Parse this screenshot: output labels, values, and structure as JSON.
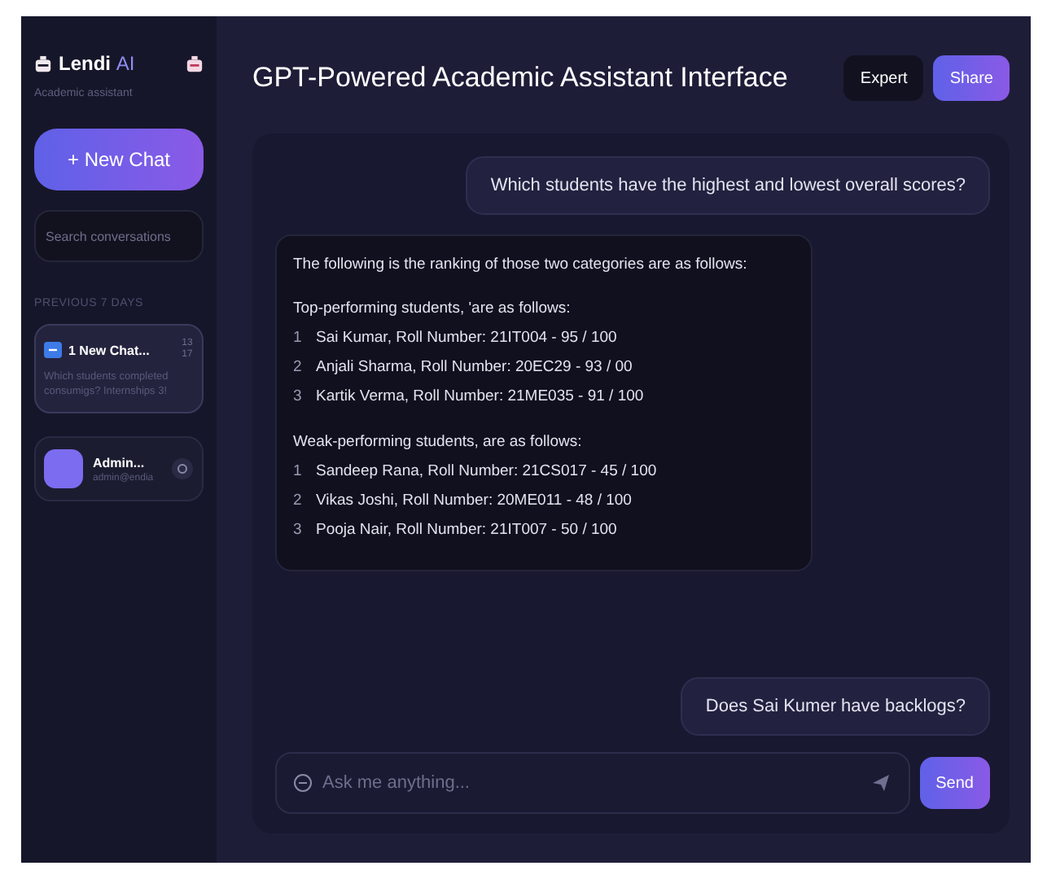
{
  "sidebar": {
    "brand": {
      "name": "Lendi",
      "suffix": "AI"
    },
    "subtitle": "Academic assistant",
    "new_chat": "+ New Chat",
    "search": {
      "placeholder": "Search conversations"
    },
    "section": "PREVIOUS 7 DAYS",
    "conversations": [
      {
        "title": "1 New Chat...",
        "time": "13 17",
        "preview": "Which students completed consumigs? Internships 3!",
        "selected": true
      }
    ],
    "user": {
      "name": "Admin...",
      "email": "admin@endia"
    }
  },
  "header": {
    "title": "GPT-Powered Academic Assistant Interface",
    "buttons": [
      {
        "label": "Expert",
        "kind": "plain"
      },
      {
        "label": "Share",
        "kind": "primary"
      }
    ]
  },
  "messages": [
    {
      "kind": "user",
      "text": "Which students have the highest and lowest overall scores?"
    },
    {
      "kind": "assistant",
      "intro": "The following is the ranking of those two categories are as follows:",
      "groups": [
        {
          "heading": "Top-performing students, 'are as follows:",
          "items": [
            {
              "num": "1",
              "text": "Sai Kumar, Roll Number: 21IT004 - 95 / 100"
            },
            {
              "num": "2",
              "text": "Anjali Sharma, Roll Number: 20EC29 - 93 / 00"
            },
            {
              "num": "3",
              "text": "Kartik Verma, Roll Number: 21ME035 - 91 / 100"
            }
          ]
        },
        {
          "heading": "Weak-performing students, are as follows:",
          "items": [
            {
              "num": "1",
              "text": "Sandeep Rana, Roll Number: 21CS017 - 45 / 100"
            },
            {
              "num": "2",
              "text": "Vikas Joshi, Roll Number: 20ME011 - 48 / 100"
            },
            {
              "num": "3",
              "text": "Pooja Nair, Roll Number: 21IT007 - 50 / 100"
            }
          ]
        }
      ]
    },
    {
      "kind": "user",
      "text": "Does Sai Kumer have backlogs?"
    }
  ],
  "composer": {
    "placeholder": "Ask me anything...",
    "send": "Send"
  }
}
